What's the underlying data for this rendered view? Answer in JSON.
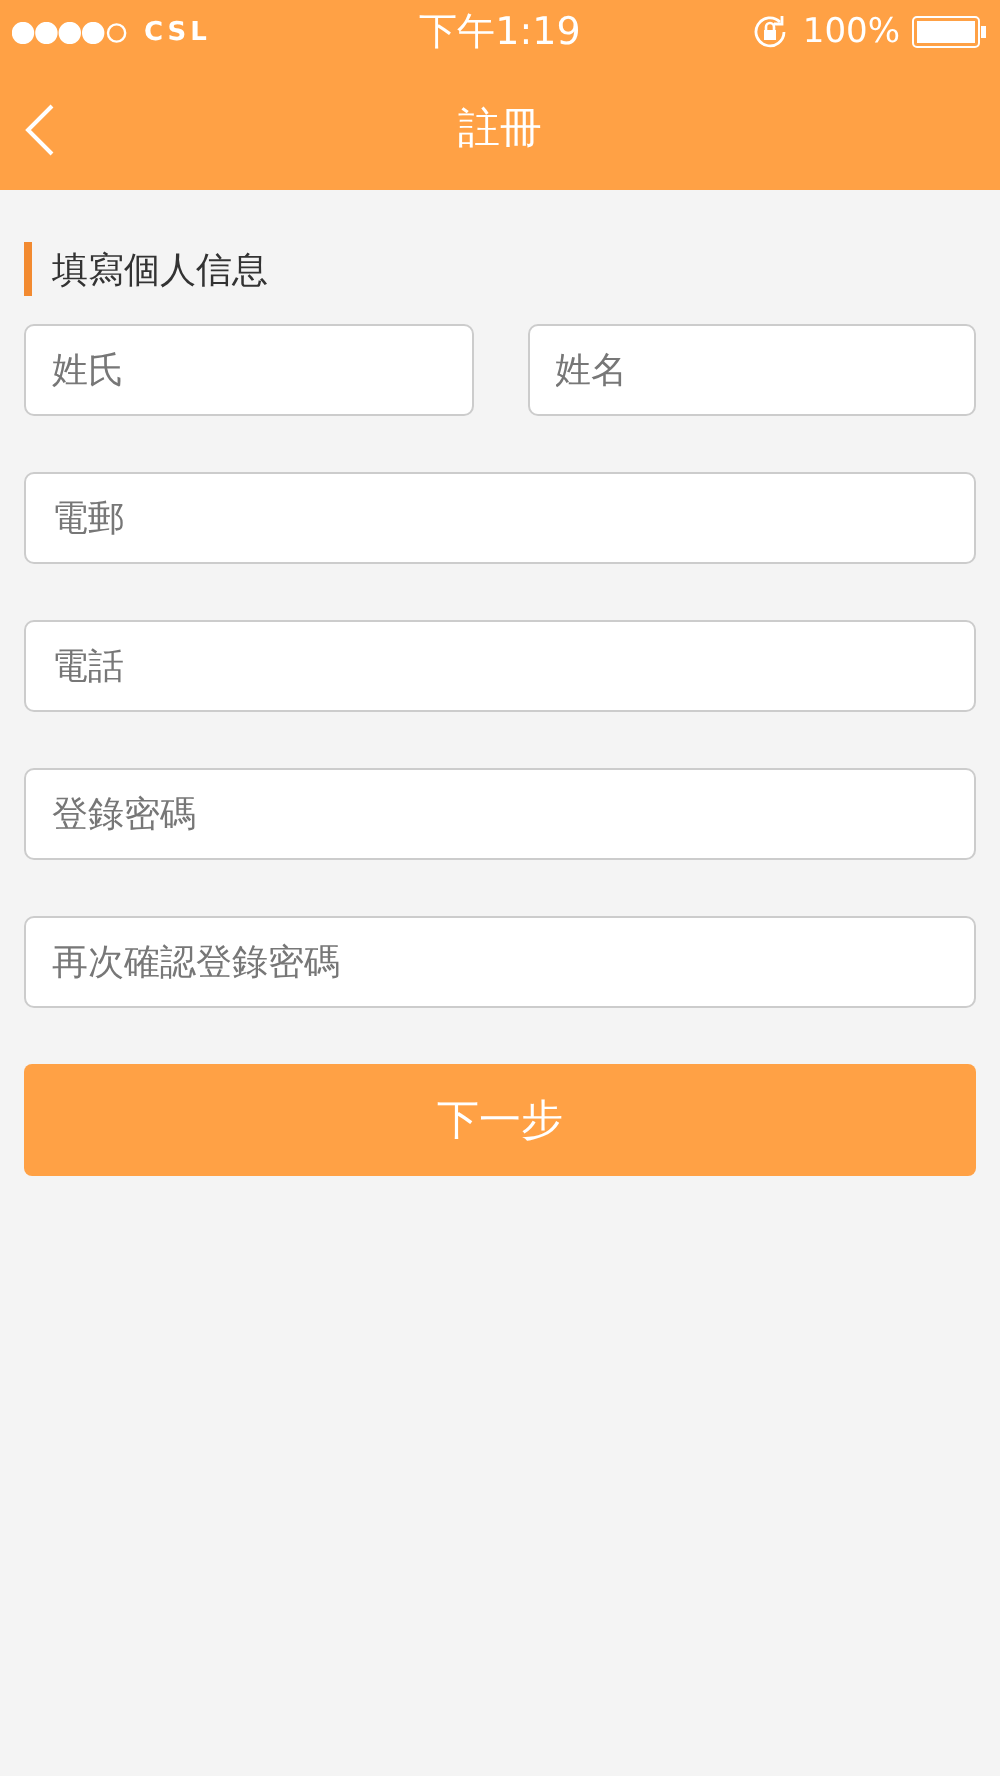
{
  "status_bar": {
    "carrier": "CSL",
    "time": "下午1:19",
    "battery": "100%"
  },
  "nav": {
    "title": "註冊"
  },
  "section": {
    "title": "填寫個人信息"
  },
  "rows": [
    {
      "fields": [
        {
          "placeholder": "姓氏"
        },
        {
          "placeholder": "姓名"
        }
      ]
    },
    {
      "fields": [
        {
          "placeholder": "電郵"
        }
      ]
    },
    {
      "fields": [
        {
          "placeholder": "電話"
        }
      ]
    },
    {
      "fields": [
        {
          "placeholder": "登錄密碼"
        }
      ]
    },
    {
      "fields": [
        {
          "placeholder": "再次確認登錄密碼"
        }
      ]
    }
  ],
  "next_button": "下一步"
}
